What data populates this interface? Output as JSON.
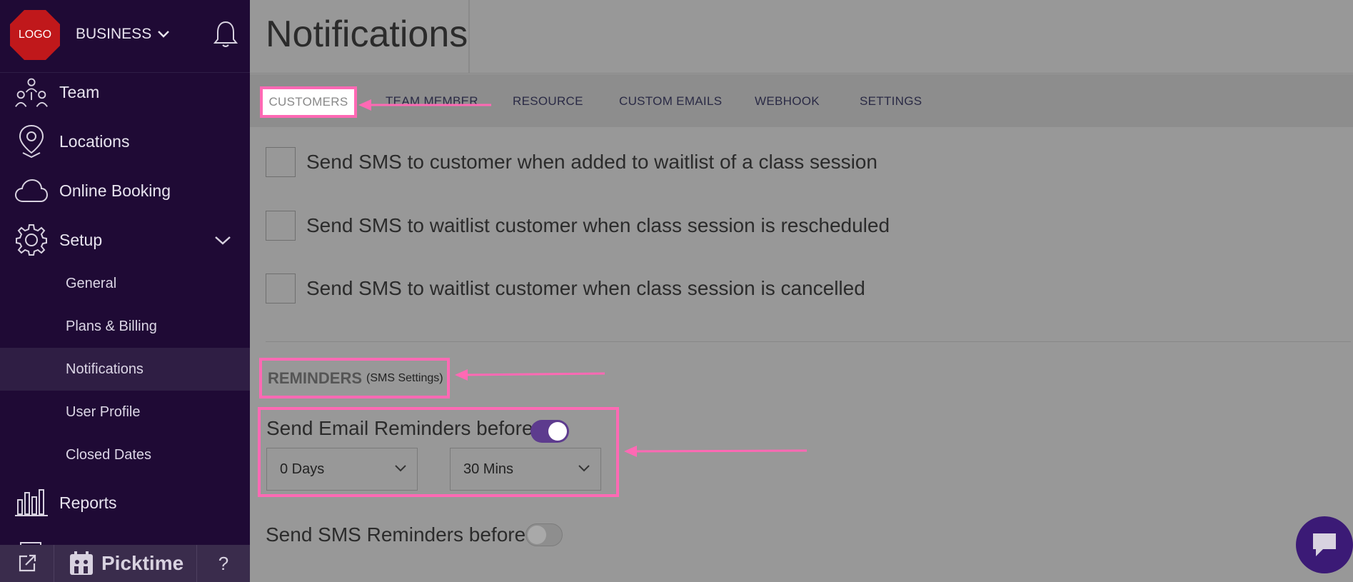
{
  "sidebar": {
    "logo_text": "LOGO",
    "business_label": "BUSINESS",
    "nav": [
      {
        "label": "Team",
        "icon": "team-icon"
      },
      {
        "label": "Locations",
        "icon": "location-pin-icon"
      },
      {
        "label": "Online Booking",
        "icon": "cloud-icon"
      },
      {
        "label": "Setup",
        "icon": "gear-icon"
      }
    ],
    "setup_sub": [
      {
        "label": "General"
      },
      {
        "label": "Plans & Billing"
      },
      {
        "label": "Notifications"
      },
      {
        "label": "User Profile"
      },
      {
        "label": "Closed Dates"
      }
    ],
    "reports_label": "Reports",
    "footer": {
      "brand": "Picktime",
      "help": "?"
    }
  },
  "main": {
    "title": "Notifications",
    "tabs": [
      {
        "label": "CUSTOMERS"
      },
      {
        "label": "TEAM MEMBER"
      },
      {
        "label": "RESOURCE"
      },
      {
        "label": "CUSTOM EMAILS"
      },
      {
        "label": "WEBHOOK"
      },
      {
        "label": "SETTINGS"
      }
    ],
    "checkboxes": [
      {
        "label": "Send SMS to customer when added to waitlist of a class session",
        "checked": false
      },
      {
        "label": "Send SMS to waitlist customer when class session is rescheduled",
        "checked": false
      },
      {
        "label": "Send SMS to waitlist customer when class session is cancelled",
        "checked": false
      }
    ],
    "reminders": {
      "title": "REMINDERS",
      "subtitle": "(SMS Settings)",
      "email_label": "Send Email Reminders before",
      "email_enabled": true,
      "days_value": "0 Days",
      "mins_value": "30 Mins",
      "sms_label": "Send SMS Reminders before",
      "sms_enabled": false
    }
  },
  "colors": {
    "sidebar_bg": "#1f0a35",
    "overlay": "#989898",
    "highlight": "#ff69b4",
    "accent": "#5d3b8e",
    "logo_red": "#c0181b"
  }
}
